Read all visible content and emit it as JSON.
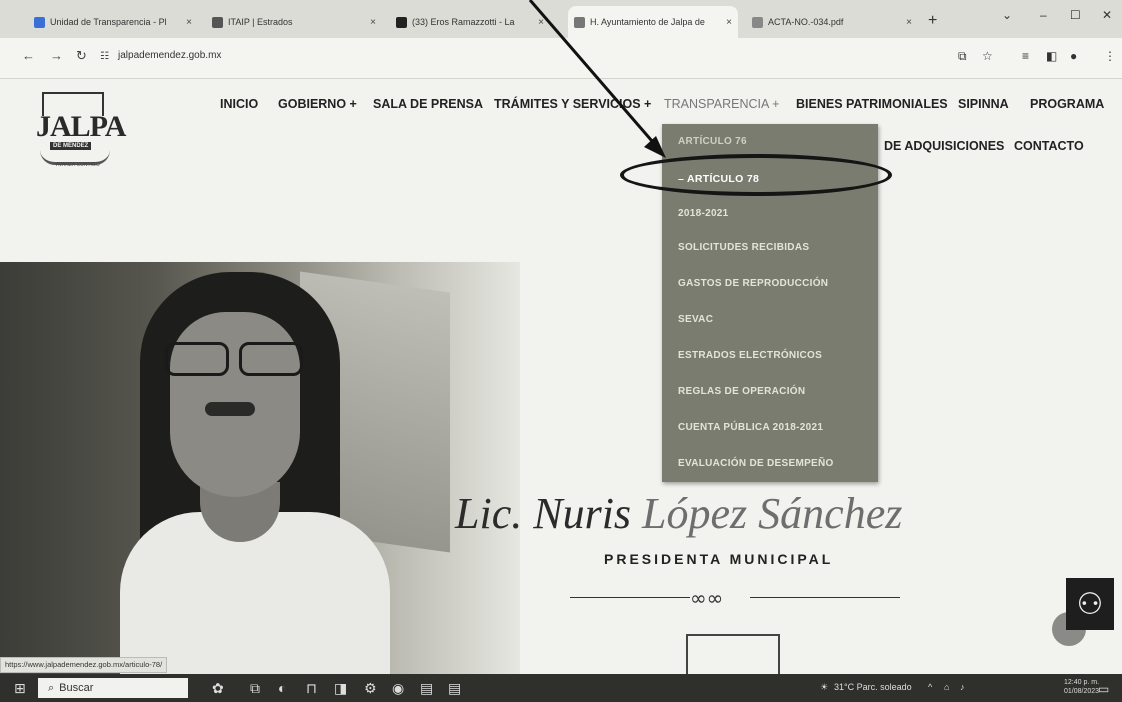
{
  "browser": {
    "tabs": [
      {
        "title": "Unidad de Transparencia - Pl",
        "close": "×",
        "color": "#3a6fd8"
      },
      {
        "title": "ITAIP | Estrados",
        "close": "×",
        "color": "#555555"
      },
      {
        "title": "(33) Eros Ramazzotti - La",
        "close": "×",
        "color": "#222222"
      },
      {
        "title": "H. Ayuntamiento de Jalpa de",
        "close": "×",
        "color": "#777777"
      },
      {
        "title": "ACTA-NO.-034.pdf",
        "close": "×",
        "color": "#888888"
      }
    ],
    "new_tab": "+",
    "url": "jalpademendez.gob.mx",
    "status_url": "https://www.jalpademendez.gob.mx/articulo-78/"
  },
  "site": {
    "logo_text": "JALPA",
    "logo_sub": "DE MÉNDEZ",
    "logo_tag": "AVANZA CONTIGO",
    "nav": [
      "INICIO",
      "GOBIERNO +",
      "SALA DE PRENSA",
      "TRÁMITES Y SERVICIOS +",
      "TRANSPARENCIA +",
      "BIENES PATRIMONIALES",
      "SIPINNA",
      "PROGRAMA"
    ],
    "nav_row2": [
      "DE ADQUISICIONES",
      "CONTACTO"
    ],
    "dropdown": [
      "ARTÍCULO 76",
      "– ARTÍCULO 78",
      "2018-2021",
      "SOLICITUDES RECIBIDAS",
      "GASTOS DE REPRODUCCIÓN",
      "SEVAC",
      "ESTRADOS ELECTRÓNICOS",
      "REGLAS DE OPERACIÓN",
      "CUENTA PÚBLICA 2018-2021",
      "EVALUACIÓN DE DESEMPEÑO"
    ],
    "hero": {
      "name_first": "Lic. Nuris",
      "name_last": "López Sánchez",
      "role": "PRESIDENTA MUNICIPAL"
    }
  },
  "taskbar": {
    "search_placeholder": "Buscar",
    "weather": "31°C Parc. soleado",
    "time": "12:40 p. m.",
    "date": "01/08/2023"
  }
}
